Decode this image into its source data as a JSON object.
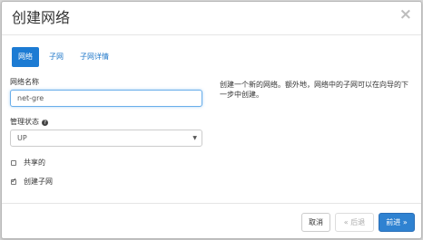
{
  "dialog": {
    "title": "创建网络",
    "close_glyph": "×"
  },
  "tabs": [
    {
      "label": "网络",
      "active": true
    },
    {
      "label": "子网",
      "active": false
    },
    {
      "label": "子网详情",
      "active": false
    }
  ],
  "form": {
    "network_name_label": "网络名称",
    "network_name_value": "net-gre",
    "admin_state_label": "管理状态",
    "help_glyph": "?",
    "admin_state_value": "UP",
    "select_caret": "▼",
    "shared_label": "共享的",
    "shared_checked": false,
    "create_subnet_label": "创建子网",
    "create_subnet_checked": true
  },
  "description": "创建一个新的网络。额外地，网络中的子网可以在向导的下一步中创建。",
  "footer": {
    "cancel_label": "取消",
    "back_label": "« 后退",
    "next_label": "前进 »"
  },
  "colors": {
    "accent": "#1c7bd3",
    "link": "#1f77c9",
    "focus_border": "#6aaeea"
  }
}
